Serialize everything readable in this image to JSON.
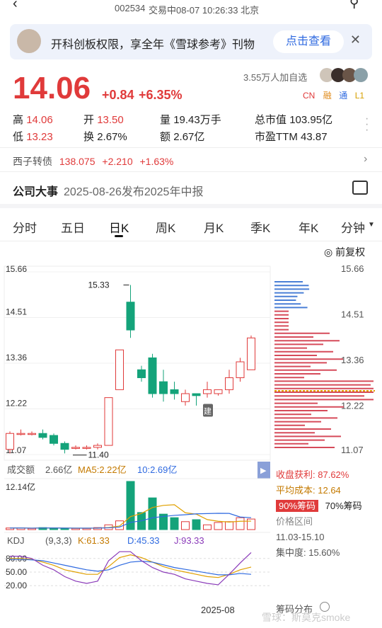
{
  "header": {
    "code": "002534",
    "status": "交易中08-07 10:26:33 北京"
  },
  "promo": {
    "text": "开科创板权限，享全年《雪球参考》刊物",
    "button": "点击查看"
  },
  "quote": {
    "price": "14.06",
    "change": "+0.84",
    "pct": "+6.35%",
    "followers": "3.55万人加自选",
    "tags": [
      "CN",
      "融",
      "通",
      "L1"
    ],
    "high_label": "高",
    "high": "14.06",
    "open_label": "开",
    "open": "13.50",
    "vol_label": "量",
    "vol": "19.43万手",
    "mcap_label": "总市值",
    "mcap": "103.95亿",
    "low_label": "低",
    "low": "13.23",
    "turn_label": "换",
    "turn": "2.67%",
    "amt_label": "额",
    "amt": "2.67亿",
    "pe_label": "市盈TTM",
    "pe": "43.87"
  },
  "bond": {
    "name": "西子转债",
    "price": "138.075",
    "change": "+2.210",
    "pct": "+1.63%"
  },
  "event": {
    "title": "公司大事",
    "text": "2025-08-26发布2025年中报"
  },
  "tabs": [
    "分时",
    "五日",
    "日K",
    "周K",
    "月K",
    "季K",
    "年K",
    "分钟"
  ],
  "chart": {
    "adjust": "前复权",
    "y_ticks": [
      "15.66",
      "14.51",
      "13.36",
      "12.22",
      "11.07"
    ],
    "max_label": "15.33",
    "min_label": "11.40",
    "mark": "建",
    "vol_title": "成交额",
    "vol_val": "2.66亿",
    "ma5": "MA5:2.22亿",
    "ma10": "10:2.69亿",
    "vol_max": "12.14亿",
    "kdj_title": "KDJ",
    "kdj_params": "(9,3,3)",
    "k": "K:61.33",
    "d": "D:45.33",
    "j": "J:93.33",
    "kdj_ticks": [
      "80.00",
      "50.00",
      "20.00"
    ],
    "date": "2025-08"
  },
  "chip": {
    "profit_label": "收盘获利:",
    "profit": "87.62%",
    "cost_label": "平均成本:",
    "cost": "12.64",
    "c90": "90%筹码",
    "c70": "70%筹码",
    "range_label": "价格区间",
    "range": "11.03-15.10",
    "conc": "集中度: 15.60%",
    "title": "筹码分布"
  },
  "watermark": "雪球：斯莫克smoke",
  "chart_data": {
    "type": "candlestick",
    "candles": [
      {
        "o": 11.2,
        "c": 11.6,
        "h": 11.65,
        "l": 11.1
      },
      {
        "o": 11.6,
        "c": 11.6,
        "h": 11.7,
        "l": 11.55
      },
      {
        "o": 11.6,
        "c": 11.6,
        "h": 11.65,
        "l": 11.55
      },
      {
        "o": 11.6,
        "c": 11.5,
        "h": 11.7,
        "l": 11.45
      },
      {
        "o": 11.55,
        "c": 11.35,
        "h": 11.6,
        "l": 11.3
      },
      {
        "o": 11.35,
        "c": 11.2,
        "h": 11.4,
        "l": 11.1
      },
      {
        "o": 11.25,
        "c": 11.25,
        "h": 11.3,
        "l": 11.2
      },
      {
        "o": 11.25,
        "c": 11.25,
        "h": 11.3,
        "l": 11.2
      },
      {
        "o": 11.25,
        "c": 11.3,
        "h": 11.35,
        "l": 11.2
      },
      {
        "o": 11.3,
        "c": 12.5,
        "h": 12.5,
        "l": 11.3
      },
      {
        "o": 12.7,
        "c": 13.7,
        "h": 13.7,
        "l": 12.7
      },
      {
        "o": 14.9,
        "c": 14.2,
        "h": 15.33,
        "l": 14.0
      },
      {
        "o": 13.2,
        "c": 13.0,
        "h": 13.3,
        "l": 12.9
      },
      {
        "o": 13.5,
        "c": 12.6,
        "h": 13.6,
        "l": 12.5
      },
      {
        "o": 12.9,
        "c": 12.6,
        "h": 13.2,
        "l": 12.4
      },
      {
        "o": 12.7,
        "c": 12.6,
        "h": 12.9,
        "l": 12.45
      },
      {
        "o": 12.4,
        "c": 12.6,
        "h": 12.7,
        "l": 12.3
      },
      {
        "o": 12.6,
        "c": 12.55,
        "h": 12.6,
        "l": 12.3
      },
      {
        "o": 12.6,
        "c": 12.7,
        "h": 12.9,
        "l": 12.5
      },
      {
        "o": 12.6,
        "c": 12.7,
        "h": 12.7,
        "l": 12.55
      },
      {
        "o": 12.7,
        "c": 13.0,
        "h": 13.2,
        "l": 12.6
      },
      {
        "o": 13.0,
        "c": 13.4,
        "h": 13.5,
        "l": 12.9
      },
      {
        "o": 13.2,
        "c": 14.0,
        "h": 14.06,
        "l": 13.2
      }
    ],
    "volume": [
      0.4,
      0.4,
      0.3,
      0.5,
      0.4,
      0.3,
      0.3,
      0.3,
      0.5,
      1.2,
      2.2,
      12.14,
      4.3,
      8.0,
      3.9,
      3.0,
      2.0,
      2.5,
      1.2,
      1.8,
      2.0,
      3.0,
      2.66
    ],
    "kdj_k": [
      80,
      80,
      78,
      72,
      65,
      55,
      50,
      45,
      45,
      62,
      82,
      88,
      82,
      72,
      62,
      55,
      50,
      45,
      40,
      38,
      45,
      55,
      61
    ],
    "kdj_d": [
      78,
      78,
      77,
      75,
      70,
      65,
      60,
      55,
      52,
      55,
      65,
      72,
      74,
      72,
      66,
      60,
      56,
      52,
      48,
      44,
      44,
      47,
      45
    ],
    "kdj_j": [
      85,
      85,
      80,
      65,
      55,
      40,
      30,
      25,
      30,
      75,
      95,
      95,
      75,
      60,
      50,
      45,
      35,
      30,
      25,
      22,
      45,
      70,
      93
    ]
  }
}
